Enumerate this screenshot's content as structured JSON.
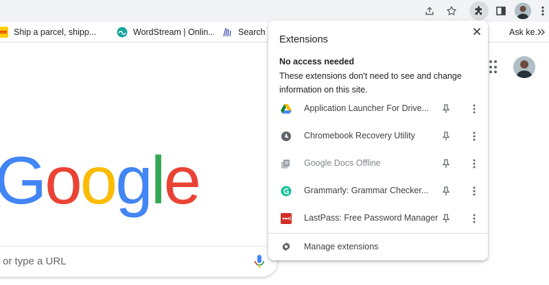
{
  "toolbar": {
    "icons": [
      "share-icon",
      "bookmark-star-icon",
      "extensions-puzzle-icon",
      "side-panel-icon",
      "profile-avatar",
      "chrome-menu-icon"
    ]
  },
  "bookmarks": [
    {
      "label": "Ship a parcel, shipp...",
      "icon": "dhl-favicon"
    },
    {
      "label": "WordStream | Onlin...",
      "icon": "wordstream-favicon"
    },
    {
      "label": "Search li",
      "icon": "search-favicon"
    },
    {
      "label": "Ask ke...",
      "icon": "bookmark-favicon"
    }
  ],
  "page": {
    "logo": [
      "G",
      "o",
      "o",
      "g",
      "l",
      "e"
    ],
    "logo_colors": [
      "#4285F4",
      "#EA4335",
      "#FBBC05",
      "#4285F4",
      "#34A853",
      "#EA4335"
    ],
    "search_placeholder": "or type a URL"
  },
  "extensions_popup": {
    "title": "Extensions",
    "section_title": "No access needed",
    "section_desc": "These extensions don't need to see and change information on this site.",
    "items": [
      {
        "name": "Application Launcher For Drive...",
        "icon": "google-drive-icon",
        "dimmed": false
      },
      {
        "name": "Chromebook Recovery Utility",
        "icon": "recovery-utility-icon",
        "dimmed": false
      },
      {
        "name": "Google Docs Offline",
        "icon": "docs-offline-icon",
        "dimmed": true
      },
      {
        "name": "Grammarly: Grammar Checker...",
        "icon": "grammarly-icon",
        "dimmed": false
      },
      {
        "name": "LastPass: Free Password Manager",
        "icon": "lastpass-icon",
        "dimmed": false
      }
    ],
    "manage_label": "Manage extensions"
  },
  "colors": {
    "toolbar_bg": "#f1f3f4",
    "text": "#202124",
    "dimmed_text": "#80868b",
    "icon_grey": "#5f6368",
    "grammarly": "#15c39a",
    "lastpass": "#d32d27"
  }
}
